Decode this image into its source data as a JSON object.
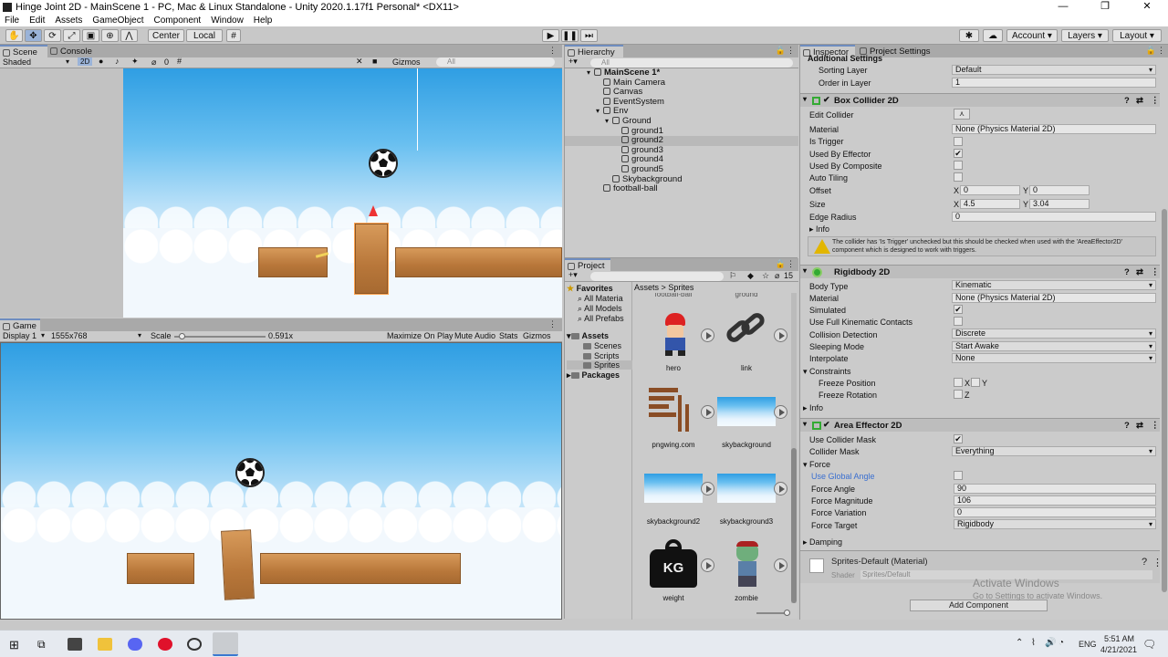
{
  "window": {
    "title": "Hinge Joint 2D - MainScene 1 - PC, Mac & Linux Standalone - Unity 2020.1.17f1 Personal* <DX11>",
    "min": "—",
    "max": "❐",
    "close": "✕"
  },
  "menu": [
    "File",
    "Edit",
    "Assets",
    "GameObject",
    "Component",
    "Window",
    "Help"
  ],
  "toolbar": {
    "center": "Center",
    "local": "Local",
    "account": "Account",
    "layers": "Layers",
    "layout": "Layout"
  },
  "scene": {
    "tab_scene": "Scene",
    "tab_console": "Console",
    "shading": "Shaded",
    "mode2d": "2D",
    "gizmos": "Gizmos",
    "search": "All",
    "layer_count": "0"
  },
  "game": {
    "tab": "Game",
    "display": "Display 1",
    "resolution": "1555x768",
    "scale_label": "Scale",
    "scale_value": "0.591x",
    "maximize": "Maximize On Play",
    "mute": "Mute Audio",
    "stats": "Stats",
    "gizmos": "Gizmos",
    "scale_fraction": 0.05
  },
  "hierarchy": {
    "tab": "Hierarchy",
    "search": "All",
    "rows": [
      {
        "label": "MainScene 1*",
        "depth": 0,
        "arrow": "▾"
      },
      {
        "label": "Main Camera",
        "depth": 1,
        "arrow": ""
      },
      {
        "label": "Canvas",
        "depth": 1,
        "arrow": ""
      },
      {
        "label": "EventSystem",
        "depth": 1,
        "arrow": ""
      },
      {
        "label": "Env",
        "depth": 1,
        "arrow": "▾"
      },
      {
        "label": "Ground",
        "depth": 2,
        "arrow": "▾"
      },
      {
        "label": "ground1",
        "depth": 3,
        "arrow": ""
      },
      {
        "label": "ground2",
        "depth": 3,
        "arrow": "",
        "selected": true
      },
      {
        "label": "ground3",
        "depth": 3,
        "arrow": ""
      },
      {
        "label": "ground4",
        "depth": 3,
        "arrow": ""
      },
      {
        "label": "ground5",
        "depth": 3,
        "arrow": ""
      },
      {
        "label": "Skybackground",
        "depth": 2,
        "arrow": ""
      },
      {
        "label": "football-ball",
        "depth": 1,
        "arrow": ""
      }
    ]
  },
  "project": {
    "tab": "Project",
    "count": "15",
    "breadcrumb_assets": "Assets",
    "breadcrumb_sep": ">",
    "breadcrumb_sprites": "Sprites",
    "favorites": "Favorites",
    "fav_items": [
      "All Materia",
      "All Models",
      "All Prefabs"
    ],
    "assets": "Assets",
    "asset_items": [
      "Scenes",
      "Scripts",
      "Sprites"
    ],
    "packages": "Packages",
    "top_cut": [
      "football-ball",
      "ground"
    ],
    "items": [
      "hero",
      "link",
      "pngwing.com",
      "skybackground",
      "skybackground2",
      "skybackground3",
      "weight",
      "zombie"
    ],
    "weight_text": "KG"
  },
  "inspector": {
    "tab": "Inspector",
    "tab2": "Project Settings",
    "additional": "Additional Settings",
    "sorting_layer_label": "Sorting Layer",
    "sorting_layer": "Default",
    "order_label": "Order in Layer",
    "order": "1",
    "box_collider": {
      "title": "Box Collider 2D",
      "edit": "Edit Collider",
      "material_label": "Material",
      "material": "None (Physics Material 2D)",
      "is_trigger": "Is Trigger",
      "used_by_effector": "Used By Effector",
      "used_by_composite": "Used By Composite",
      "auto_tiling": "Auto Tiling",
      "offset": "Offset",
      "offset_x": "0",
      "offset_y": "0",
      "size": "Size",
      "size_x": "4.5",
      "size_y": "3.04",
      "edge_radius": "Edge Radius",
      "edge_radius_val": "0",
      "info": "Info",
      "x": "X",
      "y": "Y",
      "warning": "The collider has 'Is Trigger' unchecked but this should be checked when used with the 'AreaEffector2D' component which is designed to work with triggers."
    },
    "rigidbody": {
      "title": "Rigidbody 2D",
      "body_type": "Body Type",
      "body_type_val": "Kinematic",
      "material": "Material",
      "material_val": "None (Physics Material 2D)",
      "simulated": "Simulated",
      "full_kin": "Use Full Kinematic Contacts",
      "collision": "Collision Detection",
      "collision_val": "Discrete",
      "sleeping": "Sleeping Mode",
      "sleeping_val": "Start Awake",
      "interpolate": "Interpolate",
      "interpolate_val": "None",
      "constraints": "Constraints",
      "freeze_pos": "Freeze Position",
      "freeze_rot": "Freeze Rotation",
      "x": "X",
      "y": "Y",
      "z": "Z",
      "info": "Info"
    },
    "area": {
      "title": "Area Effector 2D",
      "use_mask": "Use Collider Mask",
      "mask": "Collider Mask",
      "mask_val": "Everything",
      "force": "Force",
      "global": "Use Global Angle",
      "angle": "Force Angle",
      "angle_val": "90",
      "magnitude": "Force Magnitude",
      "magnitude_val": "106",
      "variation": "Force Variation",
      "variation_val": "0",
      "target": "Force Target",
      "target_val": "Rigidbody",
      "damping": "Damping"
    },
    "material": {
      "title": "Sprites-Default (Material)",
      "shader": "Shader",
      "shader_val": "Sprites/Default"
    },
    "add_component": "Add Component",
    "activate": "Activate Windows",
    "activate_sub": "Go to Settings to activate Windows."
  },
  "taskbar": {
    "lang": "ENG",
    "time": "5:51 AM",
    "date": "4/21/2021"
  },
  "colors": {
    "accent": "#6e8cbf",
    "sky_top": "#2f9ee3",
    "wood": "#c7884a"
  }
}
